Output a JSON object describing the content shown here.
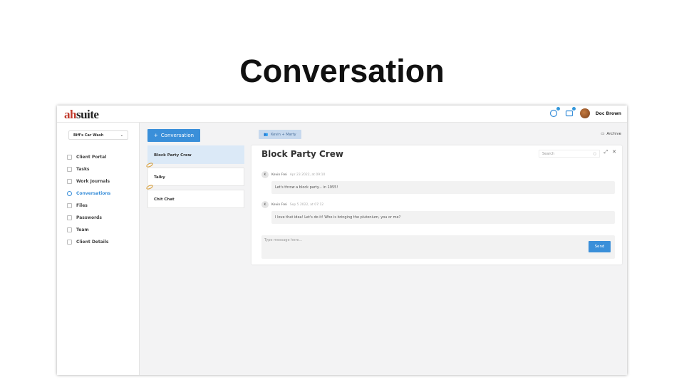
{
  "slide": {
    "title": "Conversation"
  },
  "app": {
    "logo_mark": "ah",
    "logo_text": "suite",
    "user_name": "Doc Brown",
    "company": "Biff's Car Wash",
    "nav": [
      {
        "label": "Client Portal",
        "icon": "portal-icon"
      },
      {
        "label": "Tasks",
        "icon": "tasks-icon"
      },
      {
        "label": "Work Journals",
        "icon": "journal-icon"
      },
      {
        "label": "Conversations",
        "icon": "chat-icon",
        "active": true
      },
      {
        "label": "Files",
        "icon": "folder-icon"
      },
      {
        "label": "Passwords",
        "icon": "lock-icon"
      },
      {
        "label": "Team",
        "icon": "team-icon"
      },
      {
        "label": "Client Details",
        "icon": "info-icon"
      }
    ],
    "new_conversation": "Conversation",
    "conversations": [
      {
        "title": "Block Party Crew",
        "active": true
      },
      {
        "title": "Talky"
      },
      {
        "title": "Chit Chat"
      }
    ],
    "participants_chip": "Kevin + Marty",
    "archive_label": "Archive",
    "panel": {
      "title": "Block Party Crew",
      "search_placeholder": "Search",
      "messages": [
        {
          "initial": "K",
          "author": "Kevin Frei",
          "time": "Apr 23 2022, at 09:10",
          "text": "Let's throw a block party... in 1955!"
        },
        {
          "initial": "K",
          "author": "Kevin Frei",
          "time": "Sep 5 2022, at 07:12",
          "text": "I love that idea! Let's do it! Who is bringing the plutonium, you or me?"
        }
      ],
      "compose_placeholder": "Type message here...",
      "send_label": "Send"
    },
    "colors": {
      "accent": "#3a8fd9",
      "active_row": "#dbe9f7"
    }
  }
}
